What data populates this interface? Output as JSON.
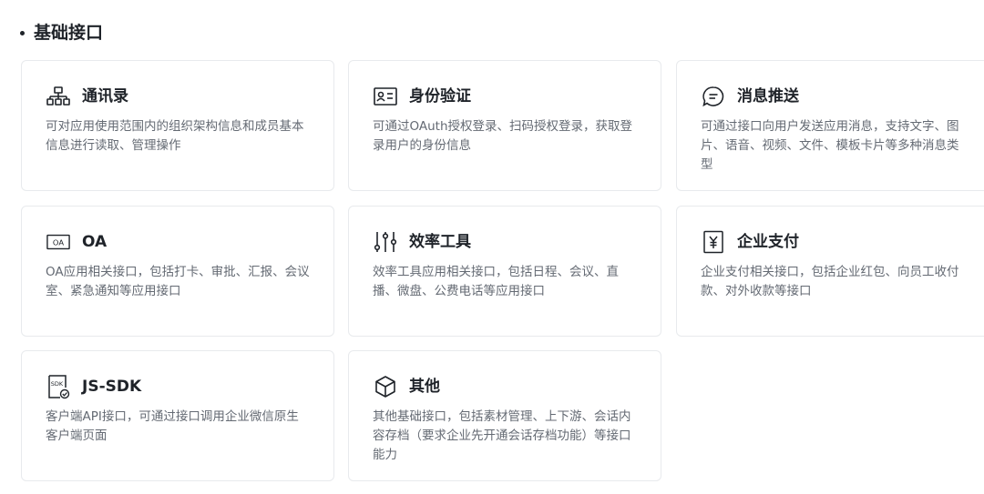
{
  "section": {
    "title": "基础接口"
  },
  "cards": [
    {
      "title": "通讯录",
      "desc": "可对应用使用范围内的组织架构信息和成员基本信息进行读取、管理操作",
      "icon": "org-chart-icon"
    },
    {
      "title": "身份验证",
      "desc": "可通过OAuth授权登录、扫码授权登录，获取登录用户的身份信息",
      "icon": "id-card-icon"
    },
    {
      "title": "消息推送",
      "desc": "可通过接口向用户发送应用消息，支持文字、图片、语音、视频、文件、模板卡片等多种消息类型",
      "icon": "chat-bubble-icon"
    },
    {
      "title": "OA",
      "desc": "OA应用相关接口，包括打卡、审批、汇报、会议室、紧急通知等应用接口",
      "icon": "oa-icon"
    },
    {
      "title": "效率工具",
      "desc": "效率工具应用相关接口，包括日程、会议、直播、微盘、公费电话等应用接口",
      "icon": "sliders-icon"
    },
    {
      "title": "企业支付",
      "desc": "企业支付相关接口，包括企业红包、向员工收付款、对外收款等接口",
      "icon": "yen-icon"
    },
    {
      "title": "JS-SDK",
      "desc": "客户端API接口，可通过接口调用企业微信原生客户端页面",
      "icon": "sdk-icon"
    },
    {
      "title": "其他",
      "desc": "其他基础接口，包括素材管理、上下游、会话内容存档（要求企业先开通会话存档功能）等接口能力",
      "icon": "cube-icon"
    }
  ]
}
